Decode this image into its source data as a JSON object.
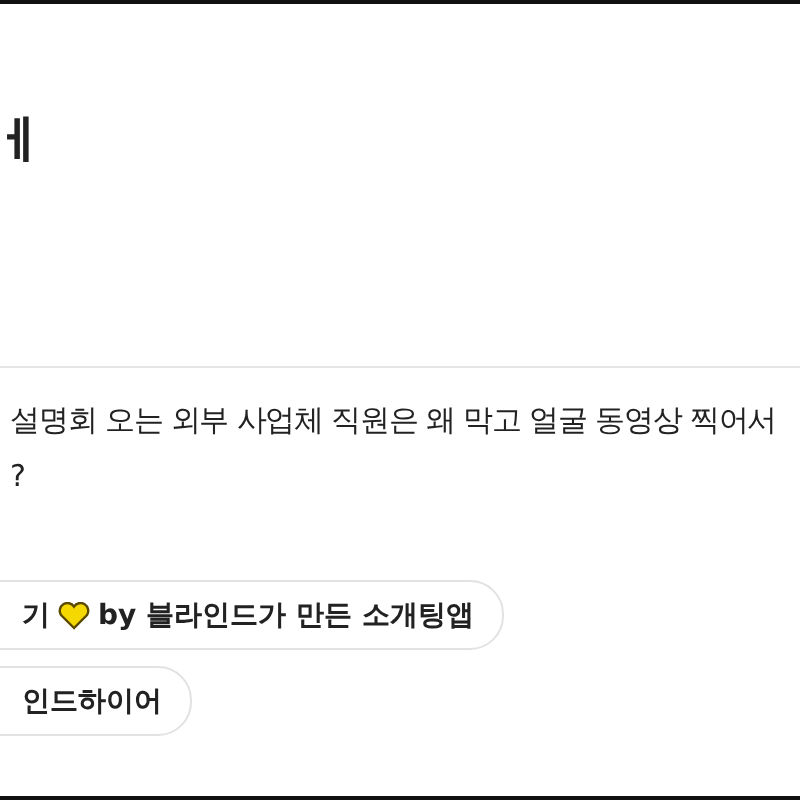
{
  "title": "ㅔ",
  "body": {
    "lines": [
      "설명회 오는 외부 사업체 직원은 왜 막고 얼굴 동영상 찍어서",
      "?"
    ]
  },
  "chips": [
    {
      "before": "기",
      "heart": true,
      "after": "by 블라인드가 만든 소개팅앱"
    },
    {
      "before": "인드하이어",
      "heart": false
    }
  ]
}
